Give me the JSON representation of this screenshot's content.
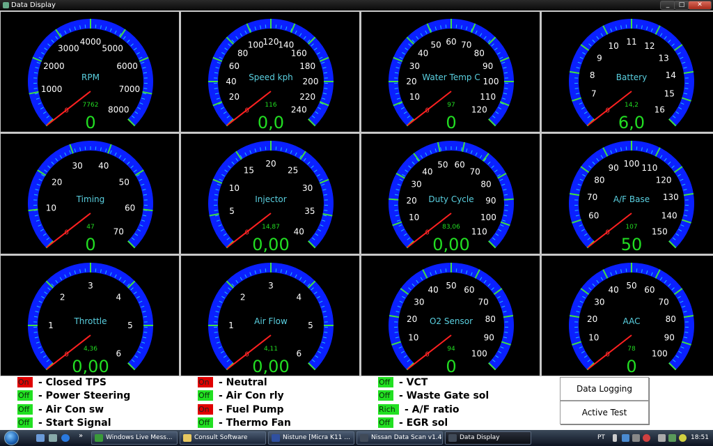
{
  "window": {
    "title": "Data Display",
    "buttons": [
      "_",
      "□",
      "✕"
    ]
  },
  "colors": {
    "arc": "#0a20ff",
    "tick_minor": "#20c0ff",
    "tick_major": "#40e040",
    "needle": "#ff2020",
    "value": "#22dd22",
    "name": "#5ad0e0",
    "on": "#e00000",
    "off": "#22e022"
  },
  "gauges": [
    {
      "name": "RPM",
      "min": 0,
      "max": 8000,
      "labels": [
        "1000",
        "2000",
        "3000",
        "4000",
        "5000",
        "6000",
        "7000",
        "8000"
      ],
      "max_reading": "7762",
      "value": "0"
    },
    {
      "name": "Speed kph",
      "min": 0,
      "max": 240,
      "labels": [
        "20",
        "40",
        "60",
        "80",
        "100",
        "120",
        "140",
        "160",
        "180",
        "200",
        "220",
        "240"
      ],
      "max_reading": "116",
      "value": "0,0"
    },
    {
      "name": "Water Temp C",
      "min": 0,
      "max": 120,
      "labels": [
        "10",
        "20",
        "30",
        "40",
        "50",
        "60",
        "70",
        "80",
        "90",
        "100",
        "110",
        "120"
      ],
      "max_reading": "97",
      "value": "0"
    },
    {
      "name": "Battery",
      "min": 6,
      "max": 16,
      "labels": [
        "7",
        "8",
        "9",
        "10",
        "11",
        "12",
        "13",
        "14",
        "15",
        "16"
      ],
      "max_reading": "14,2",
      "value": "6,0"
    },
    {
      "name": "Timing",
      "min": 0,
      "max": 70,
      "labels": [
        "10",
        "20",
        "30",
        "40",
        "50",
        "60",
        "70"
      ],
      "max_reading": "47",
      "value": "0"
    },
    {
      "name": "Injector",
      "min": 0,
      "max": 40,
      "labels": [
        "5",
        "10",
        "15",
        "20",
        "25",
        "30",
        "35",
        "40"
      ],
      "max_reading": "14,87",
      "value": "0,00"
    },
    {
      "name": "Duty Cycle",
      "min": 0,
      "max": 110,
      "labels": [
        "10",
        "20",
        "30",
        "40",
        "50",
        "60",
        "70",
        "80",
        "90",
        "100",
        "110"
      ],
      "max_reading": "83,06",
      "value": "0,00"
    },
    {
      "name": "A/F Base",
      "min": 50,
      "max": 150,
      "labels": [
        "60",
        "70",
        "80",
        "90",
        "100",
        "110",
        "120",
        "130",
        "140",
        "150"
      ],
      "max_reading": "107",
      "value": "50"
    },
    {
      "name": "Throttle",
      "min": 0,
      "max": 6,
      "labels": [
        "1",
        "2",
        "3",
        "4",
        "5",
        "6"
      ],
      "max_reading": "4,36",
      "value": "0,00"
    },
    {
      "name": "Air Flow",
      "min": 0,
      "max": 6,
      "labels": [
        "1",
        "2",
        "3",
        "4",
        "5",
        "6"
      ],
      "max_reading": "4,11",
      "value": "0,00"
    },
    {
      "name": "O2 Sensor",
      "min": 0,
      "max": 100,
      "labels": [
        "10",
        "20",
        "30",
        "40",
        "50",
        "60",
        "70",
        "80",
        "90",
        "100"
      ],
      "max_reading": "94",
      "value": "0"
    },
    {
      "name": "AAC",
      "min": 0,
      "max": 100,
      "labels": [
        "10",
        "20",
        "30",
        "40",
        "50",
        "60",
        "70",
        "80",
        "90",
        "100"
      ],
      "max_reading": "78",
      "value": "0"
    }
  ],
  "gauge_zero_label": "0",
  "status": {
    "col1": [
      {
        "state": "On",
        "label": "- Closed TPS"
      },
      {
        "state": "Off",
        "label": "- Power Steering"
      },
      {
        "state": "Off",
        "label": "- Air Con sw"
      },
      {
        "state": "Off",
        "label": "- Start Signal"
      }
    ],
    "col2": [
      {
        "state": "On",
        "label": "- Neutral"
      },
      {
        "state": "Off",
        "label": "- Air Con rly"
      },
      {
        "state": "On",
        "label": "- Fuel Pump"
      },
      {
        "state": "Off",
        "label": "- Thermo Fan"
      }
    ],
    "col3": [
      {
        "state": "Off",
        "label": "- VCT"
      },
      {
        "state": "Off",
        "label": "- Waste Gate sol"
      },
      {
        "state": "Rich",
        "label": "- A/F ratio"
      },
      {
        "state": "Off",
        "label": "- EGR sol"
      }
    ]
  },
  "buttons": {
    "data_logging": "Data Logging",
    "active_test": "Active Test"
  },
  "taskbar": {
    "overflow": "»",
    "tasks": [
      "Windows Live Mess...",
      "Consult Software",
      "Nistune [Micra K11 ...",
      "Nissan Data Scan v1.4",
      "Data Display"
    ],
    "lang": "PT",
    "clock": "18:51"
  }
}
